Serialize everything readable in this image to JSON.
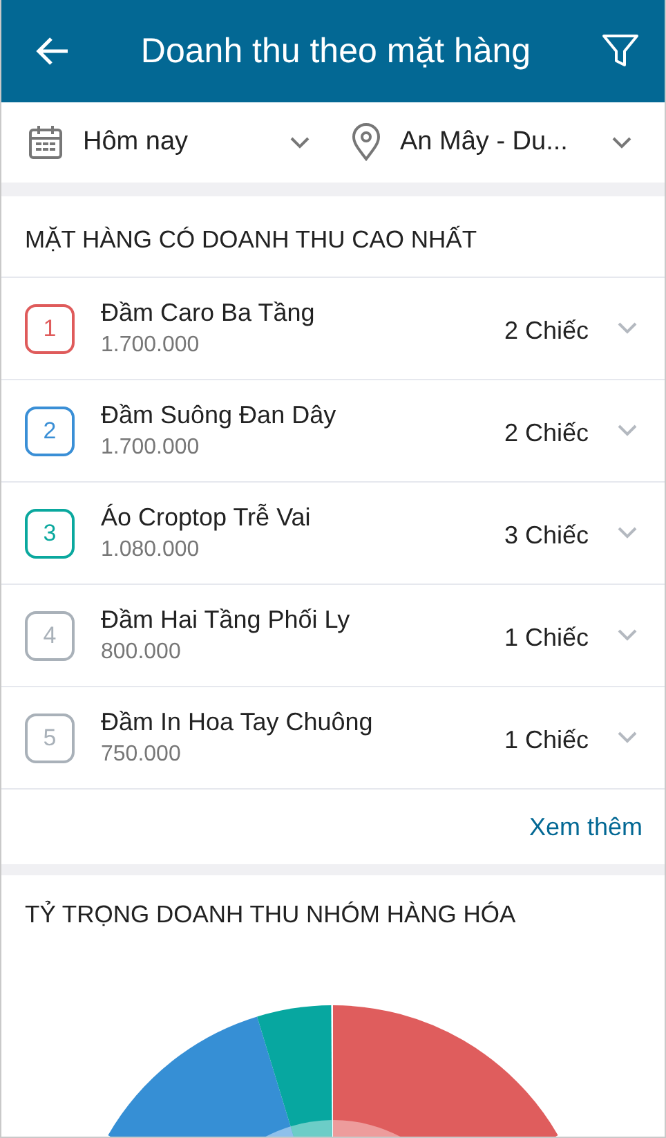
{
  "app_bar": {
    "title": "Doanh thu theo mặt hàng"
  },
  "filters": [
    {
      "kind": "date",
      "value": "Hôm nay"
    },
    {
      "kind": "location",
      "value": "An Mây - Du..."
    }
  ],
  "top_items": {
    "title": "MẶT HÀNG CÓ DOANH THU CAO NHẤT",
    "items": [
      {
        "rank": "1",
        "color": "#df5b5b",
        "name": "Đầm Caro Ba Tầng",
        "revenue": "1.700.000",
        "quantity": "2 Chiếc"
      },
      {
        "rank": "2",
        "color": "#3a8fd6",
        "name": "Đầm Suông Đan Dây",
        "revenue": "1.700.000",
        "quantity": "2 Chiếc"
      },
      {
        "rank": "3",
        "color": "#0aa89e",
        "name": "Áo Croptop Trễ Vai",
        "revenue": "1.080.000",
        "quantity": "3 Chiếc"
      },
      {
        "rank": "4",
        "color": "#a9b1b9",
        "name": "Đầm Hai Tầng Phối Ly",
        "revenue": "800.000",
        "quantity": "1 Chiếc"
      },
      {
        "rank": "5",
        "color": "#a9b1b9",
        "name": "Đầm In Hoa Tay Chuông",
        "revenue": "750.000",
        "quantity": "1 Chiếc"
      }
    ],
    "more_link": "Xem thêm"
  },
  "group_share": {
    "title": "TỶ TRỌNG DOANH THU NHÓM HÀNG HÓA"
  }
}
